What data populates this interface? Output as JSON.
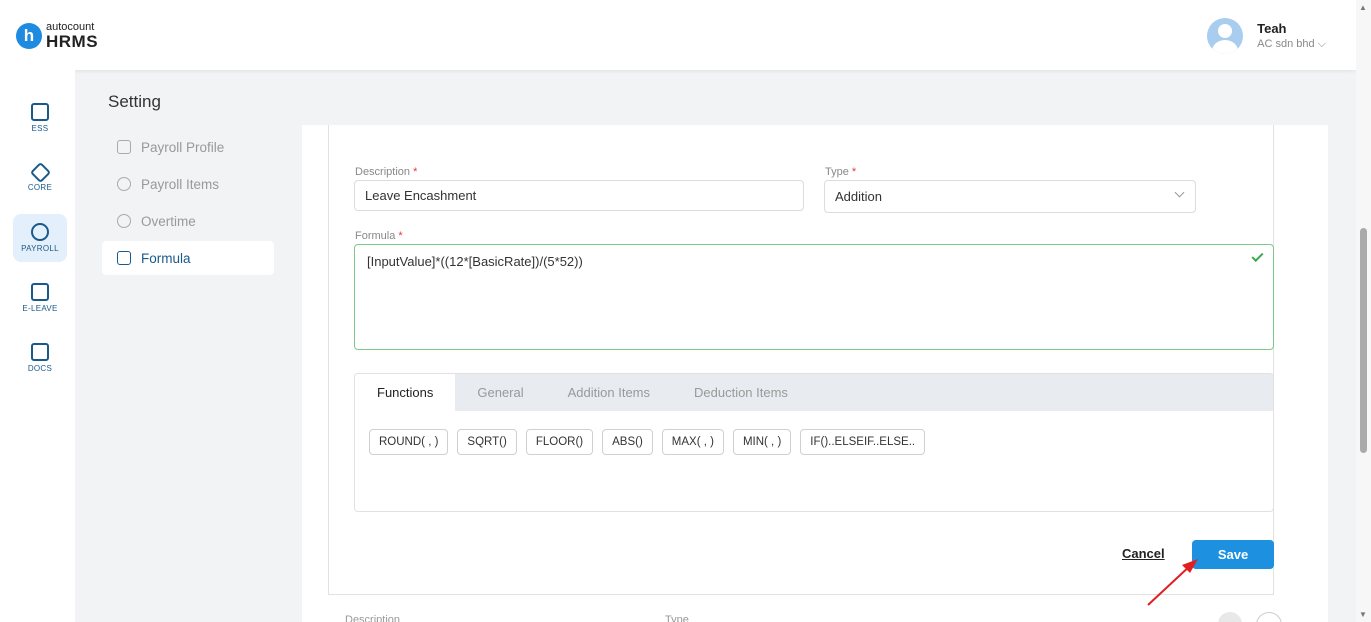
{
  "header": {
    "logo_small": "autocount",
    "logo_big": "HRMS",
    "logo_letter": "h",
    "user_name": "Teah",
    "user_company": "AC sdn bhd ⌵"
  },
  "leftnav": [
    {
      "label": "ESS",
      "icon": "ess-icon"
    },
    {
      "label": "CORE",
      "icon": "core-icon"
    },
    {
      "label": "PAYROLL",
      "icon": "payroll-icon"
    },
    {
      "label": "E-LEAVE",
      "icon": "calendar-icon"
    },
    {
      "label": "DOCS",
      "icon": "docs-icon"
    }
  ],
  "setting": {
    "title": "Setting",
    "menu": [
      "Payroll Profile",
      "Payroll Items",
      "Overtime",
      "Formula"
    ]
  },
  "form": {
    "description_label": "Description",
    "description_value": "Leave Encashment",
    "type_label": "Type",
    "type_value": "Addition",
    "formula_label": "Formula",
    "formula_value": "[InputValue]*((12*[BasicRate])/(5*52))",
    "required_mark": "*"
  },
  "tabs": [
    "Functions",
    "General",
    "Addition Items",
    "Deduction Items"
  ],
  "functions": [
    "ROUND( , )",
    "SQRT()",
    "FLOOR()",
    "ABS()",
    "MAX( , )",
    "MIN( , )",
    "IF()..ELSEIF..ELSE.."
  ],
  "actions": {
    "cancel": "Cancel",
    "save": "Save"
  },
  "table_header": {
    "description": "Description",
    "type": "Type"
  },
  "colors": {
    "primary": "#1e90e0",
    "nav_text": "#1a5a8a",
    "valid_border": "#7cc98a",
    "required": "#e53935",
    "arrow": "#e02020"
  }
}
